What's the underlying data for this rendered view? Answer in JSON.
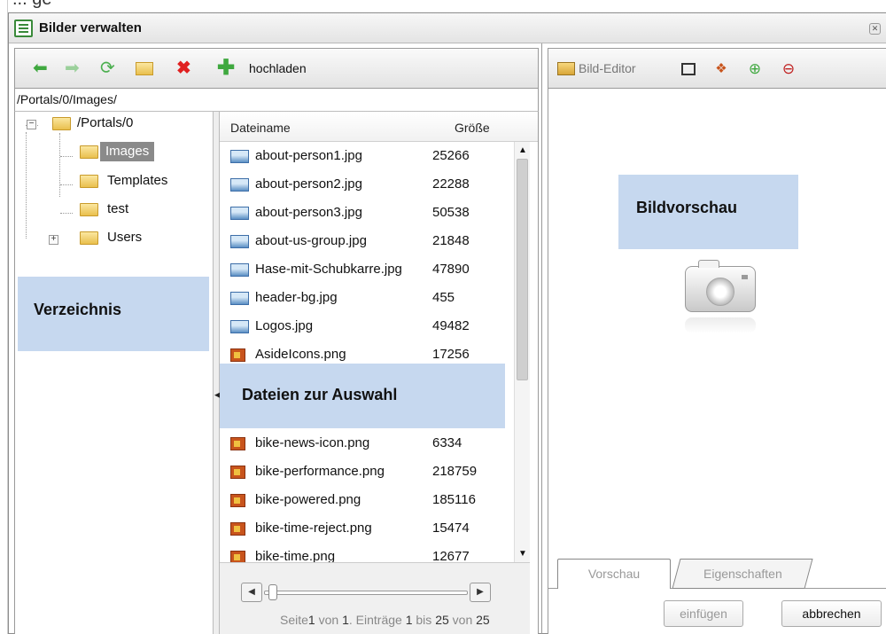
{
  "fragment": "...  ge",
  "window": {
    "title": "Bilder verwalten",
    "close_glyph": "✕"
  },
  "toolbar": {
    "upload_label": "hochladen"
  },
  "path": "/Portals/0/Images/",
  "tree": {
    "root": "/Portals/0",
    "items": [
      "Images",
      "Templates",
      "test",
      "Users"
    ],
    "selected": "Images",
    "expand_root": "−",
    "expand_users": "+"
  },
  "files": {
    "col_name": "Dateiname",
    "col_size": "Größe",
    "rows": [
      {
        "name": "about-person1.jpg",
        "size": "25266",
        "type": "jpg"
      },
      {
        "name": "about-person2.jpg",
        "size": "22288",
        "type": "jpg"
      },
      {
        "name": "about-person3.jpg",
        "size": "50538",
        "type": "jpg"
      },
      {
        "name": "about-us-group.jpg",
        "size": "21848",
        "type": "jpg"
      },
      {
        "name": "Hase-mit-Schubkarre.jpg",
        "size": "47890",
        "type": "jpg"
      },
      {
        "name": "header-bg.jpg",
        "size": "455",
        "type": "jpg"
      },
      {
        "name": "Logos.jpg",
        "size": "49482",
        "type": "jpg"
      },
      {
        "name": "AsideIcons.png",
        "size": "17256",
        "type": "png"
      },
      {
        "name": "bike-news-icon.png",
        "size": "6334",
        "type": "png"
      },
      {
        "name": "bike-performance.png",
        "size": "218759",
        "type": "png"
      },
      {
        "name": "bike-powered.png",
        "size": "185116",
        "type": "png"
      },
      {
        "name": "bike-time-reject.png",
        "size": "15474",
        "type": "png"
      },
      {
        "name": "bike-time.png",
        "size": "12677",
        "type": "png"
      }
    ]
  },
  "pager": {
    "seite": "Seite",
    "page": "1",
    "von": "von",
    "total_pages": "1",
    "eintraege": ". Einträge",
    "from": "1",
    "bis": "bis",
    "to": "25",
    "total": "25"
  },
  "preview": {
    "editor_label": "Bild-Editor",
    "tabs": [
      "Vorschau",
      "Eigenschaften"
    ],
    "insert_label": "einfügen",
    "cancel_label": "abbrechen"
  },
  "callouts": {
    "verzeichnis": "Verzeichnis",
    "dateien": "Dateien zur Auswahl",
    "bildvorschau": "Bildvorschau"
  },
  "colors": {
    "callout": "#c6d8ef",
    "green": "#3fa83f",
    "red": "#e02020",
    "selection": "#8a8a8a"
  },
  "icons": {
    "back": "arrow-left-icon",
    "forward": "arrow-right-icon",
    "refresh": "refresh-icon",
    "new_folder": "new-folder-icon",
    "delete": "delete-icon",
    "upload": "plus-icon",
    "editor": "image-editor-icon",
    "fit": "fit-to-window-icon",
    "actual_size": "actual-size-icon",
    "zoom_in": "zoom-in-icon",
    "zoom_out": "zoom-out-icon",
    "placeholder": "camera-icon"
  }
}
